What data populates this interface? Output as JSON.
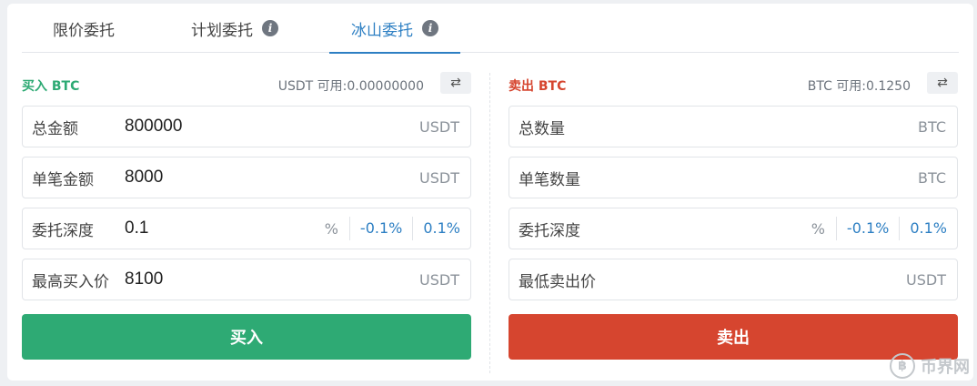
{
  "tabs": [
    {
      "label": "限价委托",
      "has_info": false
    },
    {
      "label": "计划委托",
      "has_info": true
    },
    {
      "label": "冰山委托",
      "has_info": true,
      "active": true
    }
  ],
  "info_icon_glyph": "i",
  "buy": {
    "title": "买入 BTC",
    "available": "USDT 可用:0.00000000",
    "swap_icon": "⇄",
    "fields": {
      "total": {
        "label": "总金额",
        "value": "800000",
        "unit": "USDT"
      },
      "single": {
        "label": "单笔金额",
        "value": "8000",
        "unit": "USDT"
      },
      "depth": {
        "label": "委托深度",
        "value": "0.1",
        "unit": "%",
        "minus": "-0.1%",
        "plus": "0.1%"
      },
      "limit": {
        "label": "最高买入价",
        "value": "8100",
        "unit": "USDT"
      }
    },
    "button": "买入"
  },
  "sell": {
    "title": "卖出 BTC",
    "available": "BTC 可用:0.1250",
    "swap_icon": "⇄",
    "fields": {
      "total": {
        "label": "总数量",
        "value": "",
        "unit": "BTC"
      },
      "single": {
        "label": "单笔数量",
        "value": "",
        "unit": "BTC"
      },
      "depth": {
        "label": "委托深度",
        "value": "",
        "unit": "%",
        "minus": "-0.1%",
        "plus": "0.1%"
      },
      "limit": {
        "label": "最低卖出价",
        "value": "",
        "unit": "USDT"
      }
    },
    "button": "卖出"
  },
  "colors": {
    "buy": "#2eaa74",
    "sell": "#d6452f",
    "accent": "#2d7fc3"
  },
  "watermark": {
    "logo": "฿",
    "text": "币界网"
  }
}
